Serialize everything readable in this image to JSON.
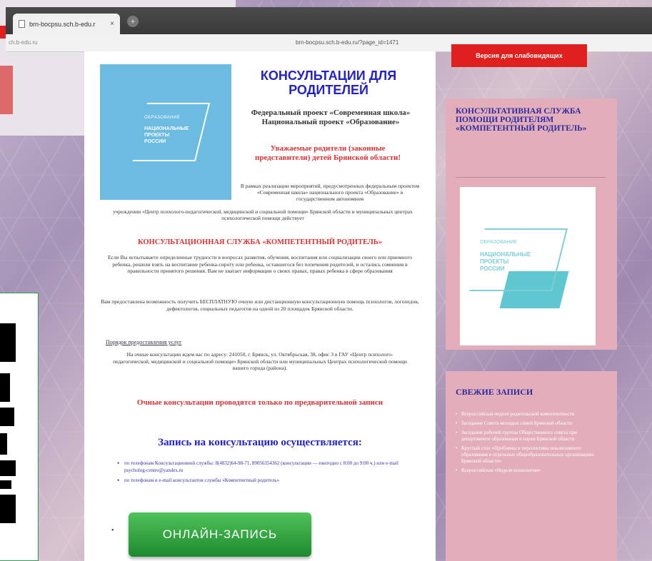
{
  "browser": {
    "tab_title": "brn-bocpsu.sch.b-edu.r",
    "tab_close": "×",
    "new_tab": "+",
    "address_left": "ch.b-edu.ru",
    "address_url": "brn-bocpsu.sch.b-edu.ru/?page_id=1471"
  },
  "article": {
    "logo_small": "ОБРАЗОВАНИЕ",
    "logo_main": "НАЦИОНАЛЬНЫЕ ПРОЕКТЫ РОССИИ",
    "title": "КОНСУЛЬТАЦИИ ДЛЯ РОДИТЕЛЕЙ",
    "subtitle": "Федеральный проект «Современная школа» Национальный проект «Образование»",
    "greeting": "Уважаемые родители (законные представители) детей Брянской области!",
    "intro_part1": "В рамках реализации мероприятий, предусмотренных федеральным проектом «Современная школа» национального проекта «Образование» в государственном автономном",
    "intro_part2": "учреждении «Центр психолого-педагогической, медицинской и социальной помощи» Брянской области и муниципальных центрах психологической помощи действует",
    "service_heading": "КОНСУЛЬТАЦИОННАЯ СЛУЖБА «КОМПЕТЕНТНЫЙ РОДИТЕЛЬ»",
    "para_problems": "Если Вы испытываете определенные трудности в вопросах развития, обучения, воспитания или социализации своего или приемного ребенка, решили взять на воспитание ребенка-сироту или ребенка, оставшегося без попечения родителей, и остались сомнения в правильности принятого решения. Вам не хватает информации о своих правах, правах ребенка в сфере образования",
    "para_free": "Вам предоставлена возможность получить БЕСПЛАТНУЮ очную или дистанционную консультационную помощь психологов, логопедов, дефектологов, социальных педагогов на одной из 20 площадок Брянской области.",
    "services_link": "Порядок предоставления услуг",
    "para_address": "На очные консультации ждем вас по адресу: 241050, г. Брянск, ул. Октябрьская, 38, офис 3 в ГАУ «Центр психолого-педагогической, медицинской и социальной помощи» Брянской области или муниципальных Центрах психологической помощи вашего города (района).",
    "warning": "Очные консультации проводятся только по предварительной записи",
    "signup_heading": "Запись на консультацию осуществляется:",
    "bullet_phone": "по телефонам Консультационной службы: 8(4832)64-98-71, 89056354362 (консультации — ежегодно с 8:00 до 9:00 ч.) или e-mail psycholog-centre@yandex.ru",
    "bullet_email": "по телефонам и e-mail консультантов службы «Компетентный родитель»",
    "online_button": "ОНЛАЙН-ЗАПИСЬ"
  },
  "sidebar": {
    "red_button": "Версия для слабовидящих",
    "card_title": "КОНСУЛЬТАТИВНАЯ СЛУЖБА ПОМОЩИ РОДИТЕЛЯМ «КОМПЕТЕНТНЫЙ РОДИТЕЛЬ»",
    "img_small": "ОБРАЗОВАНИЕ",
    "img_main": "НАЦИОНАЛЬНЫЕ ПРОЕКТЫ РОССИИ",
    "recent_title": "СВЕЖИЕ ЗАПИСИ",
    "recent": [
      "Всероссийская неделя родительской компетентности",
      "Заседание Совета молодых семей Брянской области",
      "Заседание рабочей группы Общественного совета при департаменте образования и науки Брянской области",
      "Круглый стол «Проблемы и перспективы инклюзивного образования в отдельных общеобразовательных организациях Брянской области»",
      "Всероссийская «Неделя психологии»"
    ]
  },
  "colors": {
    "accent_red": "#e01f1f",
    "title_blue": "#2222cc",
    "button_green": "#1d8a2e",
    "sidebar_pink": "#e3aeba"
  }
}
